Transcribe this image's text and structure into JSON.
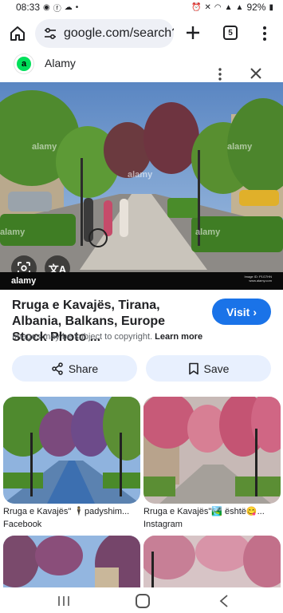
{
  "status_bar": {
    "time": "08:33",
    "battery": "92%"
  },
  "browser": {
    "url": "google.com/search?",
    "tab_count": "5"
  },
  "source": {
    "logo_letter": "a",
    "name": "Alamy",
    "logo_color": "#00e05a"
  },
  "main_image": {
    "watermark": "alamy",
    "brand": "alamy",
    "image_id": "Image ID: P1G7HN",
    "site": "www.alamy.com",
    "translate_glyph": "文A"
  },
  "result": {
    "title": "Rruga e Kavajës, Tirana, Albania, Balkans, Europe Stock Photo ...",
    "visit_label": "Visit",
    "copyright_text": "Images may be subject to copyright.",
    "learn_more": "Learn more",
    "share_label": "Share",
    "save_label": "Save",
    "accent_color": "#1a73e8"
  },
  "related": [
    {
      "caption": "Rruga e Kavajës\" 🕴️padyshim...",
      "source": "Facebook"
    },
    {
      "caption": "Rruga e Kavajës\"🏞️ është😋...",
      "source": "Instagram"
    },
    {
      "caption": "",
      "source": ""
    },
    {
      "caption": "",
      "source": ""
    }
  ]
}
